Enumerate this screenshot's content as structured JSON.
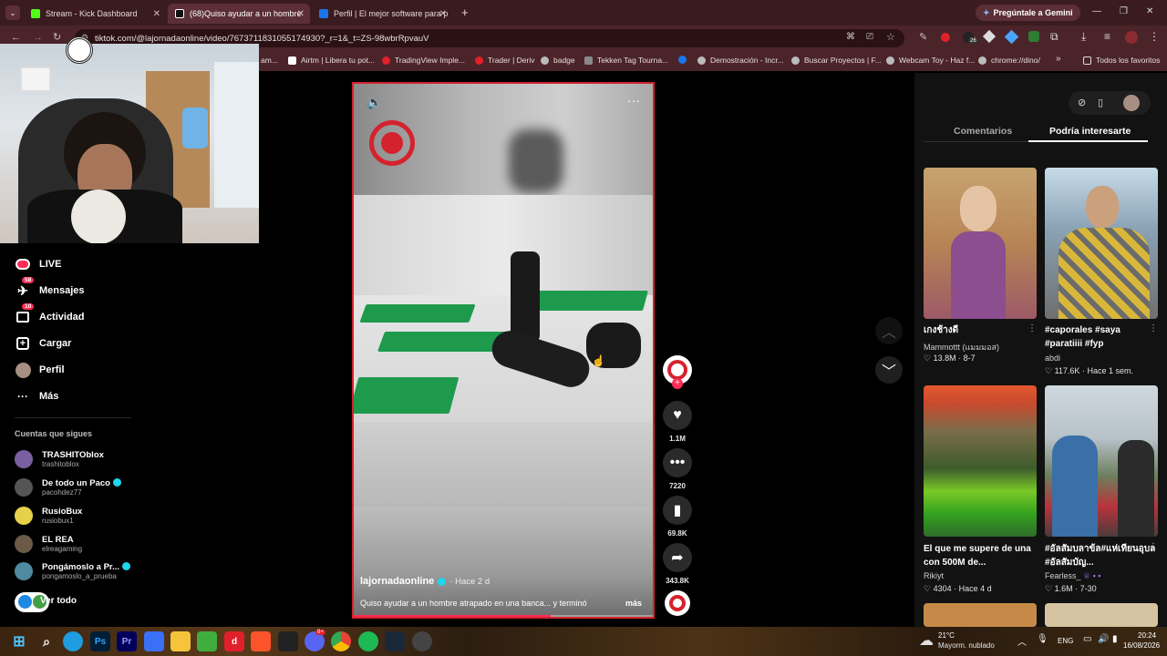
{
  "browser": {
    "tabs": [
      {
        "title": "Stream - Kick Dashboard",
        "color": "#53fc18"
      },
      {
        "title": "(68)Quiso ayudar a un hombre",
        "color": "#111111"
      },
      {
        "title": "Perfil | El mejor software para p",
        "color": "#1a73e8"
      }
    ],
    "new_tab": "+",
    "gemini_button": "Pregúntale a Gemini",
    "url": "tiktok.com/@lajornadaonline/video/7673711831055174930?_r=1&_t=ZS-98wbrRpvauV",
    "bookmarks": [
      "am...",
      "Airtm | Libera tu pot...",
      "TradingView Imple...",
      "Trader | Deriv",
      "badge",
      "Tekken Tag Tourna...",
      "Demostración - Incr...",
      "Buscar Proyectos | F...",
      "Webcam Toy - Haz f...",
      "chrome://dino/"
    ],
    "bookmarks_more": "»",
    "all_favorites": "Todos los favoritos",
    "extension_badge": "26"
  },
  "sidebar": {
    "items": [
      {
        "label": "LIVE",
        "icon": "live-icon"
      },
      {
        "label": "Mensajes",
        "icon": "messages-icon",
        "badge": "58"
      },
      {
        "label": "Actividad",
        "icon": "activity-icon",
        "badge": "10"
      },
      {
        "label": "Cargar",
        "icon": "upload-icon"
      },
      {
        "label": "Perfil",
        "icon": "profile-icon"
      },
      {
        "label": "Más",
        "icon": "more-icon"
      }
    ],
    "following_title": "Cuentas que sigues",
    "following": [
      {
        "name": "TRASHITOblox",
        "handle": "trashitoblox",
        "verified": false,
        "color": "#7a5fa0"
      },
      {
        "name": "De todo un Paco",
        "handle": "pacohdez77",
        "verified": true,
        "color": "#555555"
      },
      {
        "name": "RusioBux",
        "handle": "rusiobux1",
        "verified": false,
        "color": "#e6d24a"
      },
      {
        "name": "EL REA",
        "handle": "elreagaming",
        "verified": false,
        "color": "#6b5a45"
      },
      {
        "name": "Pongámoslo a Pr...",
        "handle": "pongamoslo_a_prueba",
        "verified": true,
        "color": "#4f8aa0"
      }
    ],
    "see_all": "Ver todo"
  },
  "video": {
    "author": "lajornadaonline",
    "posted": "· Hace 2 d",
    "description": "Quiso ayudar a un hombre atrapado en una banca... y terminó",
    "more": "más",
    "progress": 0.66
  },
  "actions": {
    "likes": "1.1M",
    "comments": "7220",
    "saves": "69.8K",
    "shares": "343.8K"
  },
  "right_panel": {
    "tabs": [
      "Comentarios",
      "Podría interesarte"
    ],
    "active_tab": 1,
    "cards": [
      {
        "caption": "เกงช้างดี",
        "author": "Mammottt (แมมมอส)",
        "likes": "13.8M",
        "date": "· 8-7"
      },
      {
        "caption": "#caporales #saya #paratiiii #fyp",
        "author": "abdi",
        "likes": "117.6K",
        "date": "· Hace 1 sem."
      },
      {
        "caption": "El que me supere de una con 500M de...",
        "author": "Rikiyt",
        "likes": "4304",
        "date": "· Hace 4 d"
      },
      {
        "caption": "#อัลสัมบลาข้ล#แห่เทียนอุบล #อัลสัมบัญ...",
        "author": "Fearless_",
        "likes": "1.6M",
        "date": "· 7-30"
      }
    ]
  },
  "taskbar": {
    "weather_temp": "21°C",
    "weather_desc": "Mayorm. nublado",
    "language": "ENG",
    "time": "20:24",
    "date": "16/08/2026",
    "discord_badge": "9+"
  }
}
